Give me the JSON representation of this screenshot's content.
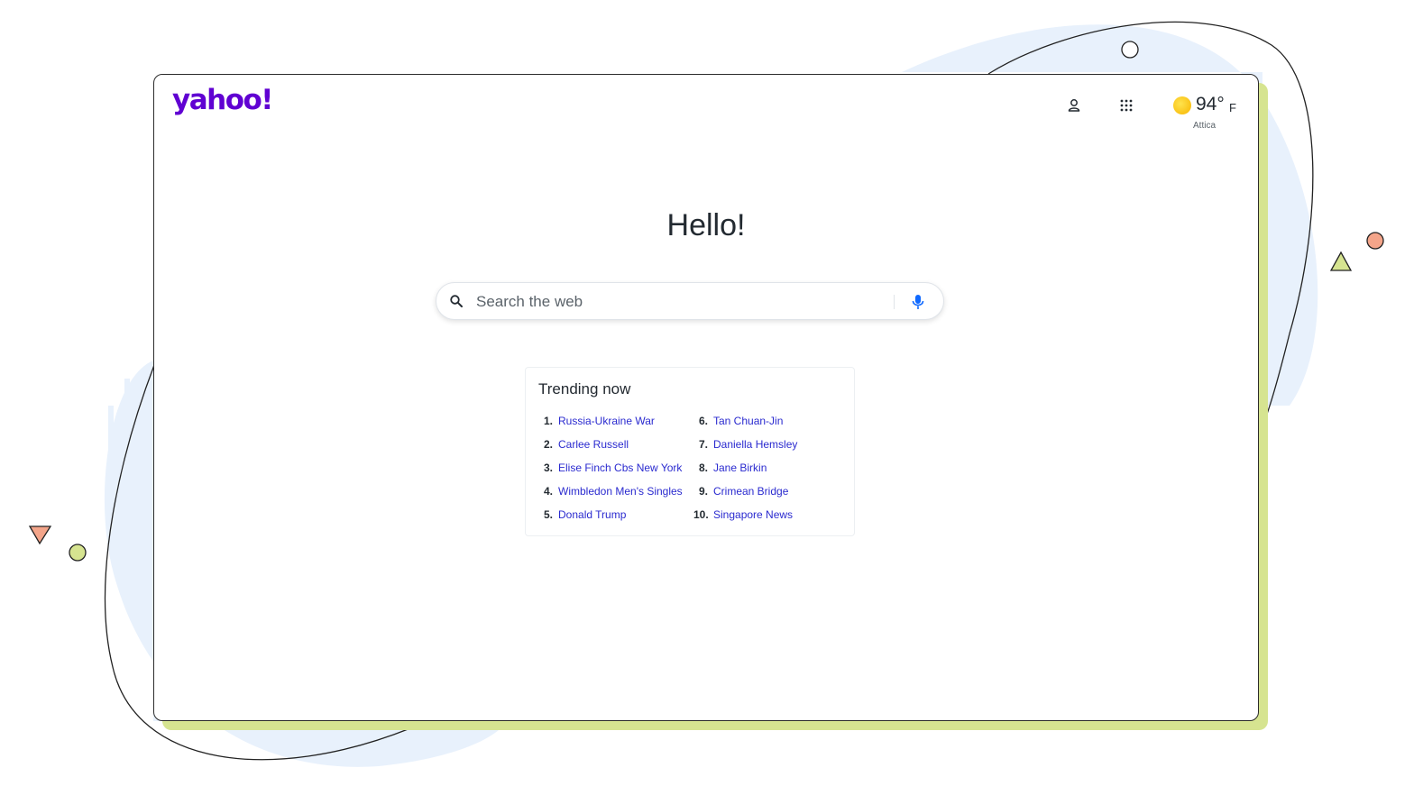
{
  "header": {
    "logo_text": "yahoo!",
    "weather": {
      "temperature": "94°",
      "unit": "F",
      "location": "Attica"
    }
  },
  "main": {
    "greeting": "Hello!",
    "search": {
      "placeholder": "Search the web",
      "value": ""
    }
  },
  "trending": {
    "title": "Trending now",
    "column1": [
      {
        "rank": "1.",
        "label": "Russia-Ukraine War"
      },
      {
        "rank": "2.",
        "label": "Carlee Russell"
      },
      {
        "rank": "3.",
        "label": "Elise Finch Cbs New York"
      },
      {
        "rank": "4.",
        "label": "Wimbledon Men's Singles"
      },
      {
        "rank": "5.",
        "label": "Donald Trump"
      }
    ],
    "column2": [
      {
        "rank": "6.",
        "label": "Tan Chuan-Jin"
      },
      {
        "rank": "7.",
        "label": "Daniella Hemsley"
      },
      {
        "rank": "8.",
        "label": "Jane Birkin"
      },
      {
        "rank": "9.",
        "label": "Crimean Bridge"
      },
      {
        "rank": "10.",
        "label": "Singapore News"
      }
    ]
  },
  "icons": {
    "profile": "user-icon",
    "apps": "grid-icon",
    "weather": "sun-icon",
    "search": "search-icon",
    "voice": "microphone-icon"
  },
  "colors": {
    "brand": "#6001d2",
    "link": "#2a2acf",
    "mic": "#0f69ff",
    "accent_green": "#d6e490",
    "accent_blue": "#e8f1fc",
    "accent_orange": "#f4a58a"
  }
}
